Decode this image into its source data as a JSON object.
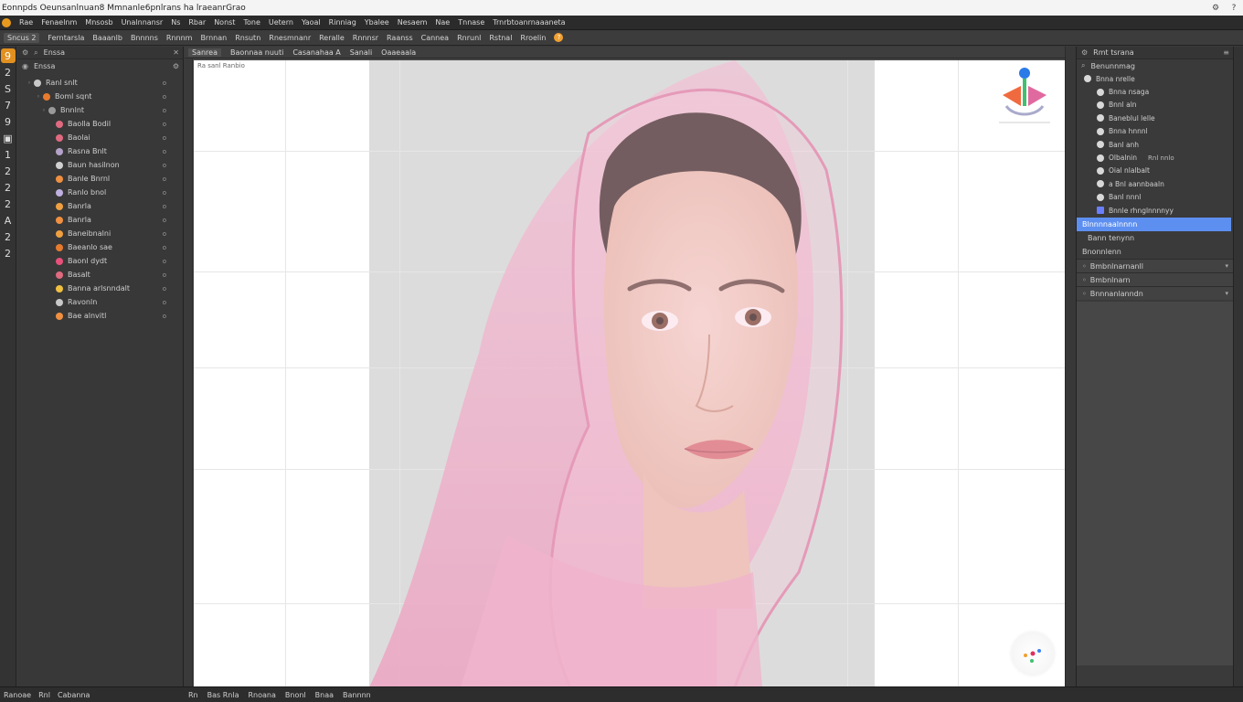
{
  "window": {
    "title": "Eonnpds  Oeunsanlnuan8  Mmnanle6pnlrans  ha lraeanrGrao",
    "help_btn": "?",
    "settings_btn": "⚙"
  },
  "menu": [
    "Rae",
    "Fenaelnm",
    "Mnsosb",
    "Unalnnansr",
    "Ns",
    "Rbar",
    "Nonst",
    "Tone",
    "Uetern",
    "Yaoal",
    "Rinniag",
    "Ybalee",
    "Nesaem",
    "Nae",
    "Tnnase",
    "Trnrbtoanrnaaaneta"
  ],
  "options_bar": {
    "preset": "Sncus 2",
    "items": [
      "Ferntarsla",
      "Baaanlb",
      "Bnnnns",
      "Rnnnm",
      "Brnnan",
      "Rnsutn",
      "Rnesmnanr",
      "Reralle",
      "Rnnnsr",
      "Raanss",
      "Cannea",
      "Rnrunl",
      "Rstnal",
      "Rroelin"
    ],
    "badge": "?"
  },
  "toolbox": [
    "9",
    "2",
    "S",
    "7",
    "9",
    "▣",
    "1",
    "2",
    "2",
    "2",
    "A",
    "2",
    "2"
  ],
  "left_panel": {
    "header": "Enssa",
    "layers": [
      {
        "name": "Ranl snlt",
        "color": "#c8c8c8",
        "indent": 4
      },
      {
        "name": "Boml sqnt",
        "color": "#e87a2e",
        "indent": 14
      },
      {
        "name": "Bnnlnt",
        "color": "#9a9a9a",
        "indent": 20
      },
      {
        "name": "Baolla Bodil",
        "color": "#e06a80",
        "indent": 28
      },
      {
        "name": "Baolai",
        "color": "#e06a80",
        "indent": 28
      },
      {
        "name": "Rasna Bnlt",
        "color": "#b4a2c8",
        "indent": 28
      },
      {
        "name": "Baun hasilnon",
        "color": "#d0d0d0",
        "indent": 28
      },
      {
        "name": "Banle Bnrnl",
        "color": "#f09040",
        "indent": 28
      },
      {
        "name": "Ranlo bnol",
        "color": "#c0b0e0",
        "indent": 28
      },
      {
        "name": "Banrla",
        "color": "#f0a040",
        "indent": 28
      },
      {
        "name": "Banrla",
        "color": "#f09040",
        "indent": 28
      },
      {
        "name": "Baneibnalni",
        "color": "#f0a040",
        "indent": 28
      },
      {
        "name": "Baeanlo sae",
        "color": "#e87a2e",
        "indent": 28
      },
      {
        "name": "Baonl dydt",
        "color": "#e8507a",
        "indent": 28
      },
      {
        "name": "Basalt",
        "color": "#e06a80",
        "indent": 28
      },
      {
        "name": "Banna arlsnndalt",
        "color": "#f0c040",
        "indent": 28
      },
      {
        "name": "Ravonln",
        "color": "#c8c8c8",
        "indent": 28
      },
      {
        "name": "Bae alnvitl",
        "color": "#f09040",
        "indent": 28
      }
    ]
  },
  "canvas": {
    "tabs": [
      "Sanrea",
      "Baonnaa nuuti",
      "Casanahaa A",
      "Sanali",
      "Oaaeaala"
    ],
    "doc_label": "Ra sanl  Ranbio"
  },
  "right_panel": {
    "header": "Rmt tsrana",
    "sub_header": "Benunnmag",
    "tree": [
      {
        "label": "Bnna nrelle",
        "indent": 8,
        "blue": false,
        "extra": ""
      },
      {
        "label": "Bnna nsaga",
        "indent": 22,
        "blue": false,
        "extra": ""
      },
      {
        "label": "Bnnl aln",
        "indent": 22,
        "blue": false,
        "extra": ""
      },
      {
        "label": "Baneblul lelle",
        "indent": 22,
        "blue": false,
        "extra": ""
      },
      {
        "label": "Bnna hnnnl",
        "indent": 22,
        "blue": false,
        "extra": ""
      },
      {
        "label": "Banl anh",
        "indent": 22,
        "blue": false,
        "extra": ""
      },
      {
        "label": "Olbalnin",
        "indent": 22,
        "blue": false,
        "extra": "Rnl nnlo"
      },
      {
        "label": "Oial nlalbalt",
        "indent": 22,
        "blue": false,
        "extra": ""
      },
      {
        "label": "a Bnl aannbaaln",
        "indent": 22,
        "blue": false,
        "extra": ""
      },
      {
        "label": "Banl nnnl",
        "indent": 22,
        "blue": false,
        "extra": ""
      },
      {
        "label": "Bnnle rhnglnnnnyy",
        "indent": 22,
        "blue": true,
        "extra": ""
      }
    ],
    "selected": "Blnnnnaalnnnn",
    "plain": "Bann tenynn",
    "small": "Bnonnlenn",
    "sections": [
      {
        "label": "Bmbnlnarnanll",
        "chev": "▾"
      },
      {
        "label": "Bmbnlnarn",
        "chev": ""
      },
      {
        "label": "Bnnnanlanndn",
        "chev": "▾"
      }
    ]
  },
  "status": {
    "left": [
      "Ranoae",
      "Rnl",
      "Cabanna"
    ],
    "canvas": [
      "Rn",
      "Bas Rnla",
      "Rnoana",
      "Bnonl",
      "Bnaa",
      "Bannnn"
    ]
  },
  "colors": {
    "accent": "#e2901f",
    "selection": "#5d8ff0"
  }
}
